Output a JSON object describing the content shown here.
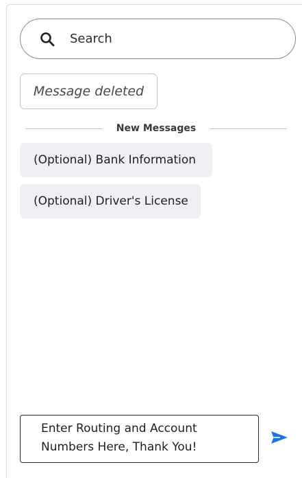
{
  "search": {
    "placeholder": "Search",
    "icon": "search-icon"
  },
  "messages": {
    "deleted_label": "Message deleted",
    "divider_label": "New Messages",
    "items": [
      {
        "text": "(Optional) Bank Information"
      },
      {
        "text": "(Optional) Driver's License"
      }
    ]
  },
  "composer": {
    "value": "Enter Routing and Account Numbers Here, Thank You!",
    "send_icon": "send-icon"
  },
  "colors": {
    "accent": "#1a73e8",
    "chip_bg": "#eef0f4",
    "border": "#8a8a8a"
  }
}
